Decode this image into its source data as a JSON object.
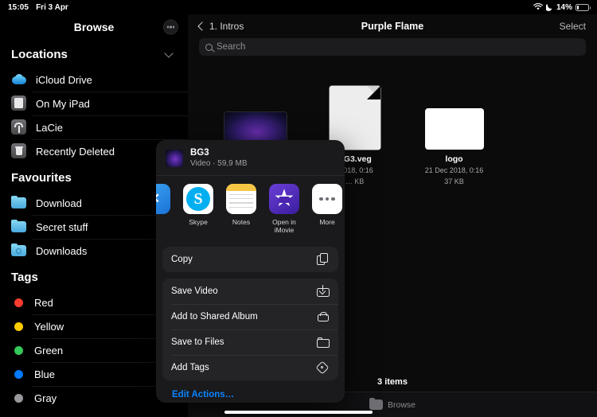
{
  "status_bar": {
    "time": "15:05",
    "date": "Fri 3 Apr",
    "wifi_icon": "wifi-icon",
    "dnd_icon": "moon-icon",
    "battery_percent": "14%",
    "battery_icon": "battery-icon"
  },
  "sidebar": {
    "title": "Browse",
    "more_button": "more-circle-button",
    "sections": [
      {
        "title": "Locations",
        "collapsible": true,
        "items": [
          {
            "label": "iCloud Drive",
            "icon": "icloud-icon"
          },
          {
            "label": "On My iPad",
            "icon": "ipad-icon"
          },
          {
            "label": "LaCie",
            "icon": "usb-drive-icon"
          },
          {
            "label": "Recently Deleted",
            "icon": "trash-icon"
          }
        ]
      },
      {
        "title": "Favourites",
        "collapsible": false,
        "items": [
          {
            "label": "Download",
            "icon": "folder-icon"
          },
          {
            "label": "Secret stuff",
            "icon": "folder-icon"
          },
          {
            "label": "Downloads",
            "icon": "downloads-folder-icon"
          }
        ]
      },
      {
        "title": "Tags",
        "collapsible": false,
        "items": [
          {
            "label": "Red",
            "icon": "tag-dot-icon",
            "color": "#ff3b30"
          },
          {
            "label": "Yellow",
            "icon": "tag-dot-icon",
            "color": "#ffcc00"
          },
          {
            "label": "Green",
            "icon": "tag-dot-icon",
            "color": "#34c759"
          },
          {
            "label": "Blue",
            "icon": "tag-dot-icon",
            "color": "#007aff"
          },
          {
            "label": "Gray",
            "icon": "tag-dot-icon",
            "color": "#98989d"
          }
        ]
      }
    ]
  },
  "main": {
    "back_label": "1. Intros",
    "back_icon": "chevron-left-icon",
    "title": "Purple Flame",
    "select_label": "Select",
    "search": {
      "placeholder": "Search",
      "value": "",
      "icon": "search-icon"
    },
    "files": [
      {
        "name": "",
        "date": "",
        "size": "",
        "icon": "video-thumbnail"
      },
      {
        "name": "BG3.veg",
        "date": "…018, 0:16",
        "size": "… KB",
        "icon": "document-icon"
      },
      {
        "name": "logo",
        "date": "21 Dec 2018, 0:16",
        "size": "37 KB",
        "icon": "image-icon"
      }
    ],
    "items_count": "3 items",
    "tab_bar": [
      {
        "label": "Browse",
        "icon": "folder-icon"
      }
    ]
  },
  "share_sheet": {
    "file_name": "BG3",
    "file_meta": "Video · 59,9 MB",
    "file_thumb": "video-thumbnail",
    "apps": [
      {
        "label": "",
        "icon": "clipped-app-icon"
      },
      {
        "label": "Skype",
        "icon": "skype-icon"
      },
      {
        "label": "Notes",
        "icon": "notes-icon"
      },
      {
        "label": "Open in iMovie",
        "icon": "imovie-icon"
      },
      {
        "label": "More",
        "icon": "more-icon"
      }
    ],
    "action_groups": [
      [
        {
          "label": "Copy",
          "icon": "copy-icon"
        }
      ],
      [
        {
          "label": "Save Video",
          "icon": "save-download-icon"
        },
        {
          "label": "Add to Shared Album",
          "icon": "shared-album-icon"
        },
        {
          "label": "Save to Files",
          "icon": "folder-icon"
        },
        {
          "label": "Add Tags",
          "icon": "tag-icon"
        }
      ]
    ],
    "edit_actions_label": "Edit Actions…",
    "accent_color": "#0a84ff"
  }
}
